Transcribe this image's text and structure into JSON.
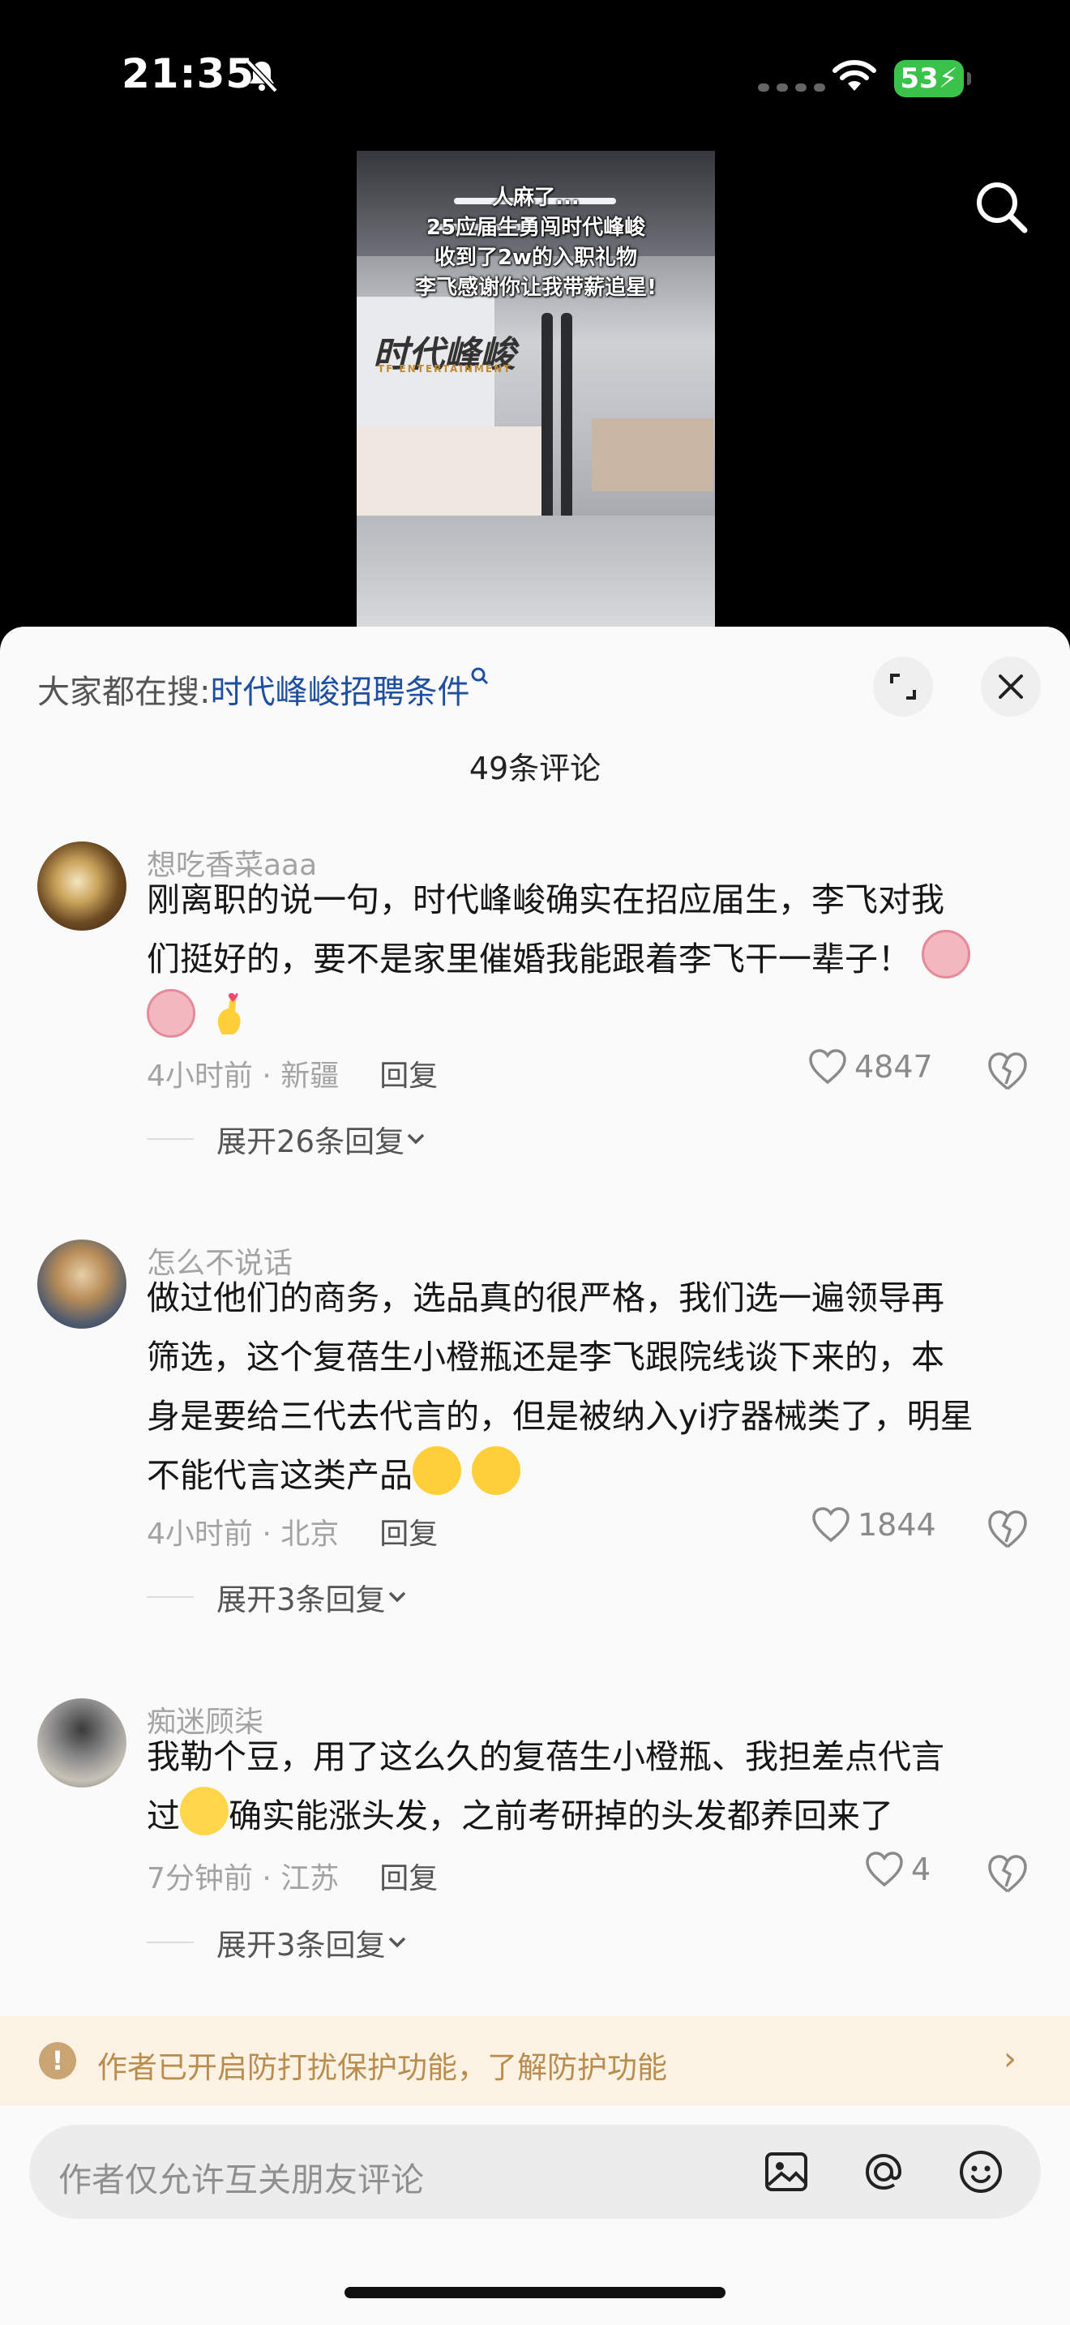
{
  "status_bar": {
    "time": "21:35",
    "battery": "53"
  },
  "video": {
    "caption_lines": [
      "人麻了...",
      "25应届生勇闯时代峰峻",
      "收到了2w的入职礼物",
      "李飞感谢你让我带薪追星!"
    ],
    "brand_text": "时代峰峻",
    "brand_en": "TF ENTERTAINMENT"
  },
  "panel": {
    "suggest_prefix": "大家都在搜:",
    "suggest_term": "时代峰峻招聘条件",
    "comment_count": "49条评论"
  },
  "comments": [
    {
      "username": "想吃香菜aaa",
      "text_line1": "刚离职的说一句，时代峰峻确实在招应届生，李飞对我",
      "text_line2": "们挺好的，要不是家里催婚我能跟着李飞干一辈子！",
      "time_loc": "4小时前 · 新疆",
      "reply": "回复",
      "likes": "4847",
      "expand": "展开26条回复"
    },
    {
      "username": "怎么不说话",
      "text_line1": "做过他们的商务，选品真的很严格，我们选一遍领导再",
      "text_line2": "筛选，这个复蓓生小橙瓶还是李飞跟院线谈下来的，本",
      "text_line3": "身是要给三代去代言的，但是被纳入yi疗器械类了，明星",
      "text_line4": "不能代言这类产品",
      "time_loc": "4小时前 · 北京",
      "reply": "回复",
      "likes": "1844",
      "expand": "展开3条回复"
    },
    {
      "username": "痴迷顾柒",
      "text_line1": "我勒个豆，用了这么久的复蓓生小橙瓶、我担差点代言",
      "text_line2a": "过",
      "text_line2b": "确实能涨头发，之前考研掉的头发都养回来了",
      "time_loc": "7分钟前 · 江苏",
      "reply": "回复",
      "likes": "4",
      "expand": "展开3条回复"
    }
  ],
  "notice": {
    "text": "作者已开启防打扰保护功能，了解防护功能"
  },
  "input": {
    "placeholder": "作者仅允许互关朋友评论"
  },
  "colors": {
    "accent_link": "#1f4fa0",
    "notice_bg": "#fbf2e3",
    "notice_text": "#b88d4f",
    "battery": "#3ac24a"
  }
}
